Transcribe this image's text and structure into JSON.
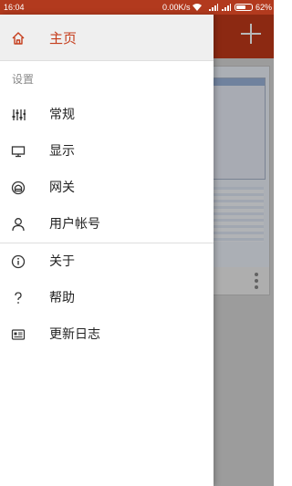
{
  "status_bar": {
    "time": "16:04",
    "network_speed": "0.00K/s",
    "battery_percent": "62%"
  },
  "drawer": {
    "home": {
      "label": "主页",
      "icon": "home-icon",
      "color": "#c53d1c"
    },
    "section_title": "设置",
    "settings_items": [
      {
        "label": "常规",
        "icon": "sliders-icon"
      },
      {
        "label": "显示",
        "icon": "monitor-icon"
      },
      {
        "label": "网关",
        "icon": "gateway-icon"
      },
      {
        "label": "用户帐号",
        "icon": "user-icon"
      }
    ],
    "other_items": [
      {
        "label": "关于",
        "icon": "info-icon"
      },
      {
        "label": "帮助",
        "icon": "question-icon"
      },
      {
        "label": "更新日志",
        "icon": "changelog-icon"
      }
    ]
  },
  "background_app": {
    "toolbar_color": "#c23a1a",
    "add_icon": "plus-icon",
    "menu_icon": "more-vertical-icon"
  }
}
